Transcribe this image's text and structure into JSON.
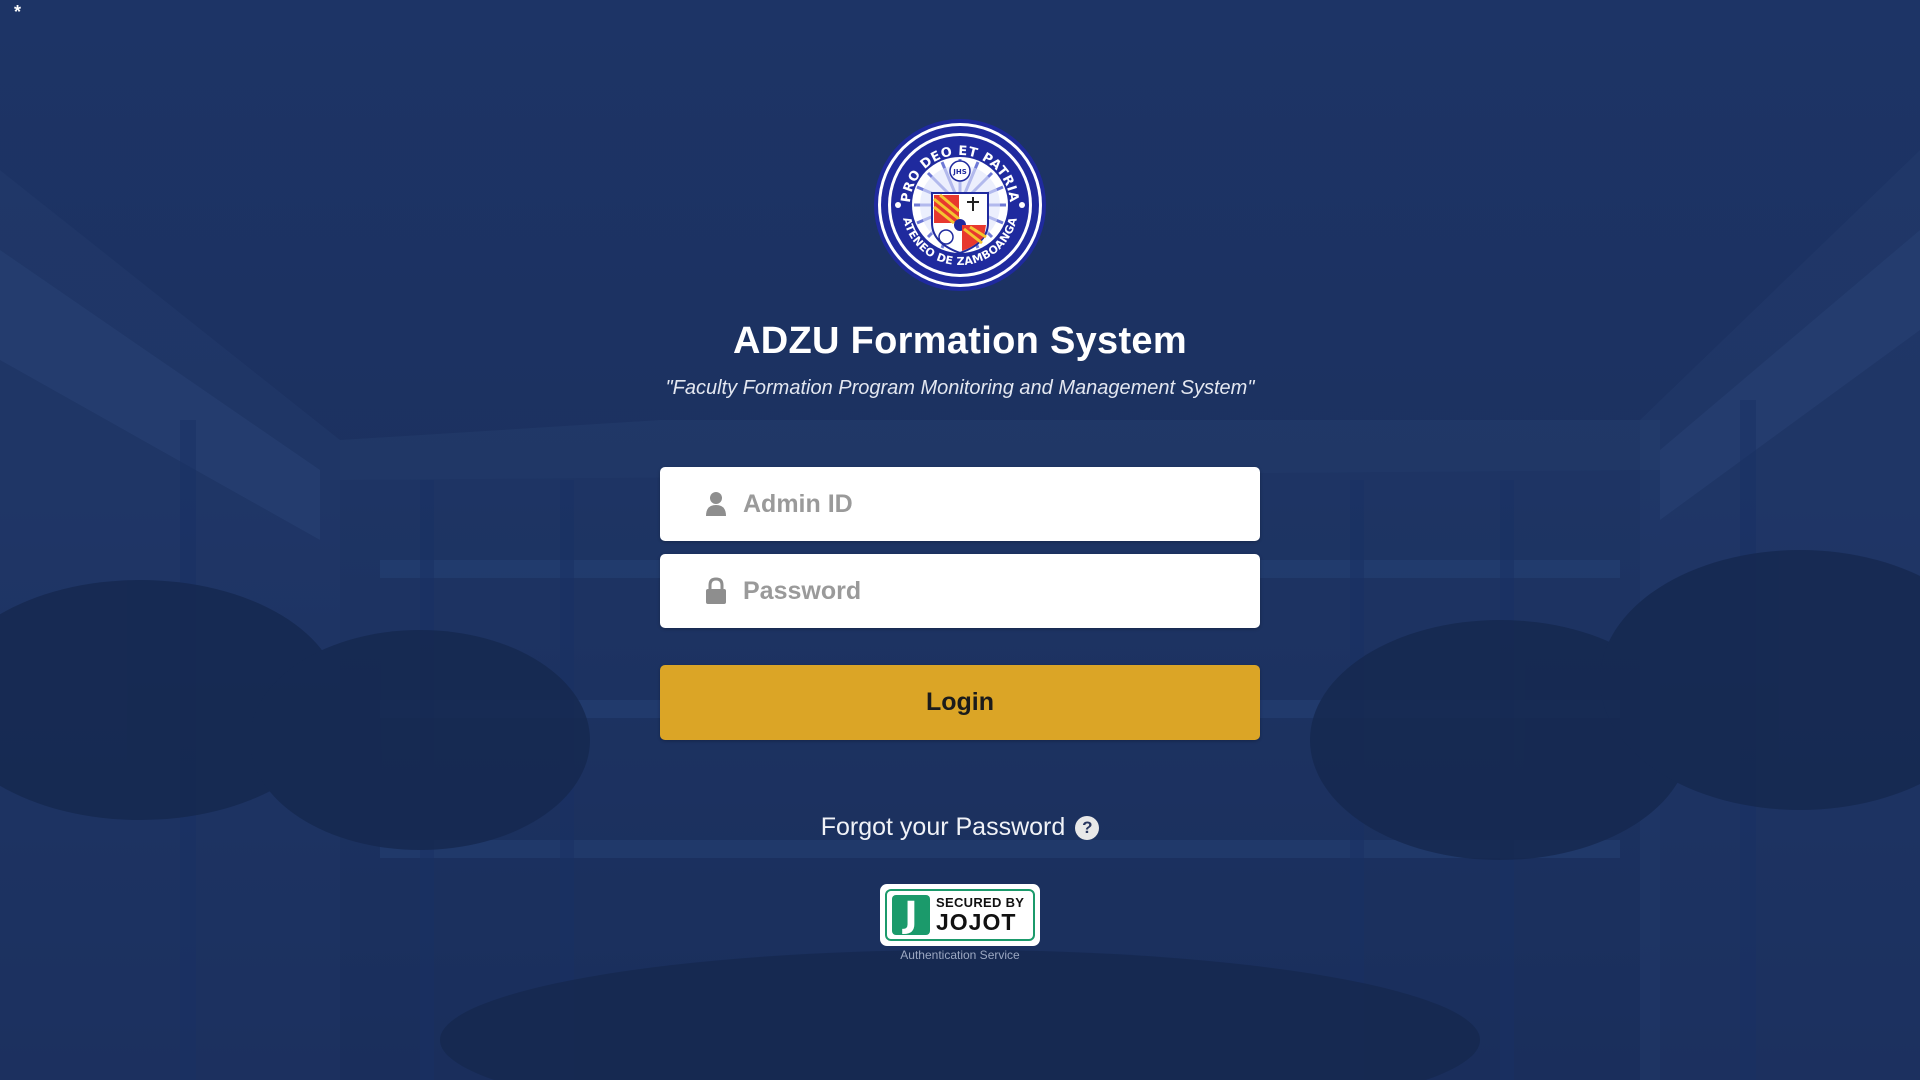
{
  "page": {
    "corner_mark": "*",
    "background_color": "#1a2e5c"
  },
  "header": {
    "seal": {
      "top_text": "PRO DEO ET PATRIA",
      "bottom_text": "ATENEO DE ZAMBOANGA",
      "monogram": "JHS",
      "icon": "university-seal"
    },
    "title": "ADZU Formation System",
    "subtitle": "\"Faculty Formation Program Monitoring and Management System\""
  },
  "form": {
    "admin_id": {
      "placeholder": "Admin ID",
      "value": "",
      "icon": "user-icon"
    },
    "password": {
      "placeholder": "Password",
      "value": "",
      "icon": "lock-icon"
    },
    "login_label": "Login",
    "login_color": "#dba526"
  },
  "forgot": {
    "label": "Forgot your Password",
    "help_glyph": "?",
    "icon": "help-icon"
  },
  "badge": {
    "letter": "J",
    "line1": "SECURED BY",
    "line2": "JOJOT",
    "caption": "Authentication Service",
    "accent": "#1b9a6b"
  }
}
